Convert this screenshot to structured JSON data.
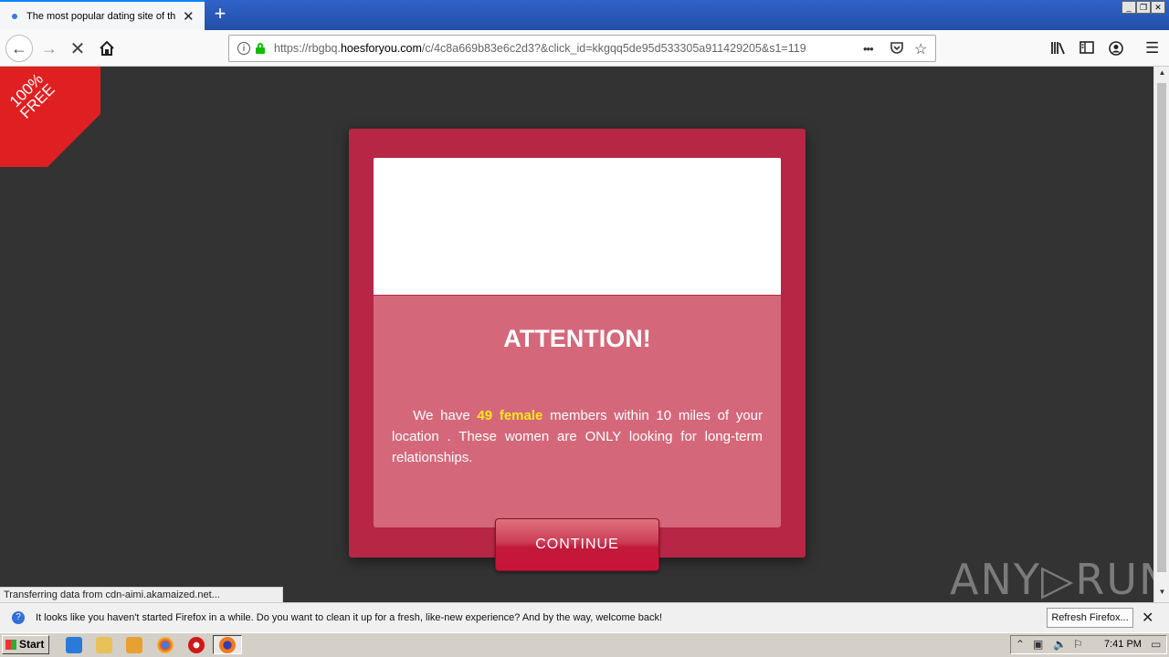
{
  "browser": {
    "tab_title": "The most popular dating site of th",
    "new_tab": "+",
    "url_prefix": "https://rbgbq.",
    "url_domain": "hoesforyou.com",
    "url_path": "/c/4c8a669b83e6c2d3?&click_id=kkgqq5de95d533305a911429205&s1=119",
    "more_icon": "•••"
  },
  "page": {
    "ribbon_line1": "100%",
    "ribbon_line2": "FREE",
    "title": "ATTENTION!",
    "text_before": "We have ",
    "highlight": "49 female",
    "text_after": " members within 10 miles of your location . These women are ONLY looking for long-term relationships.",
    "button": "CONTINUE",
    "status": "Transferring data from cdn-aimi.akamaized.net...",
    "watermark": "ANY▷RUN"
  },
  "notification": {
    "text": "It looks like you haven't started Firefox in a while. Do you want to clean it up for a fresh, like-new experience? And by the way, welcome back!",
    "button": "Refresh Firefox..."
  },
  "taskbar": {
    "start": "Start",
    "clock": "7:41 PM"
  },
  "colors": {
    "modal": "#b72644",
    "modal_body": "#d4687a",
    "highlight": "#ffe81a",
    "ribbon": "#e02020"
  }
}
